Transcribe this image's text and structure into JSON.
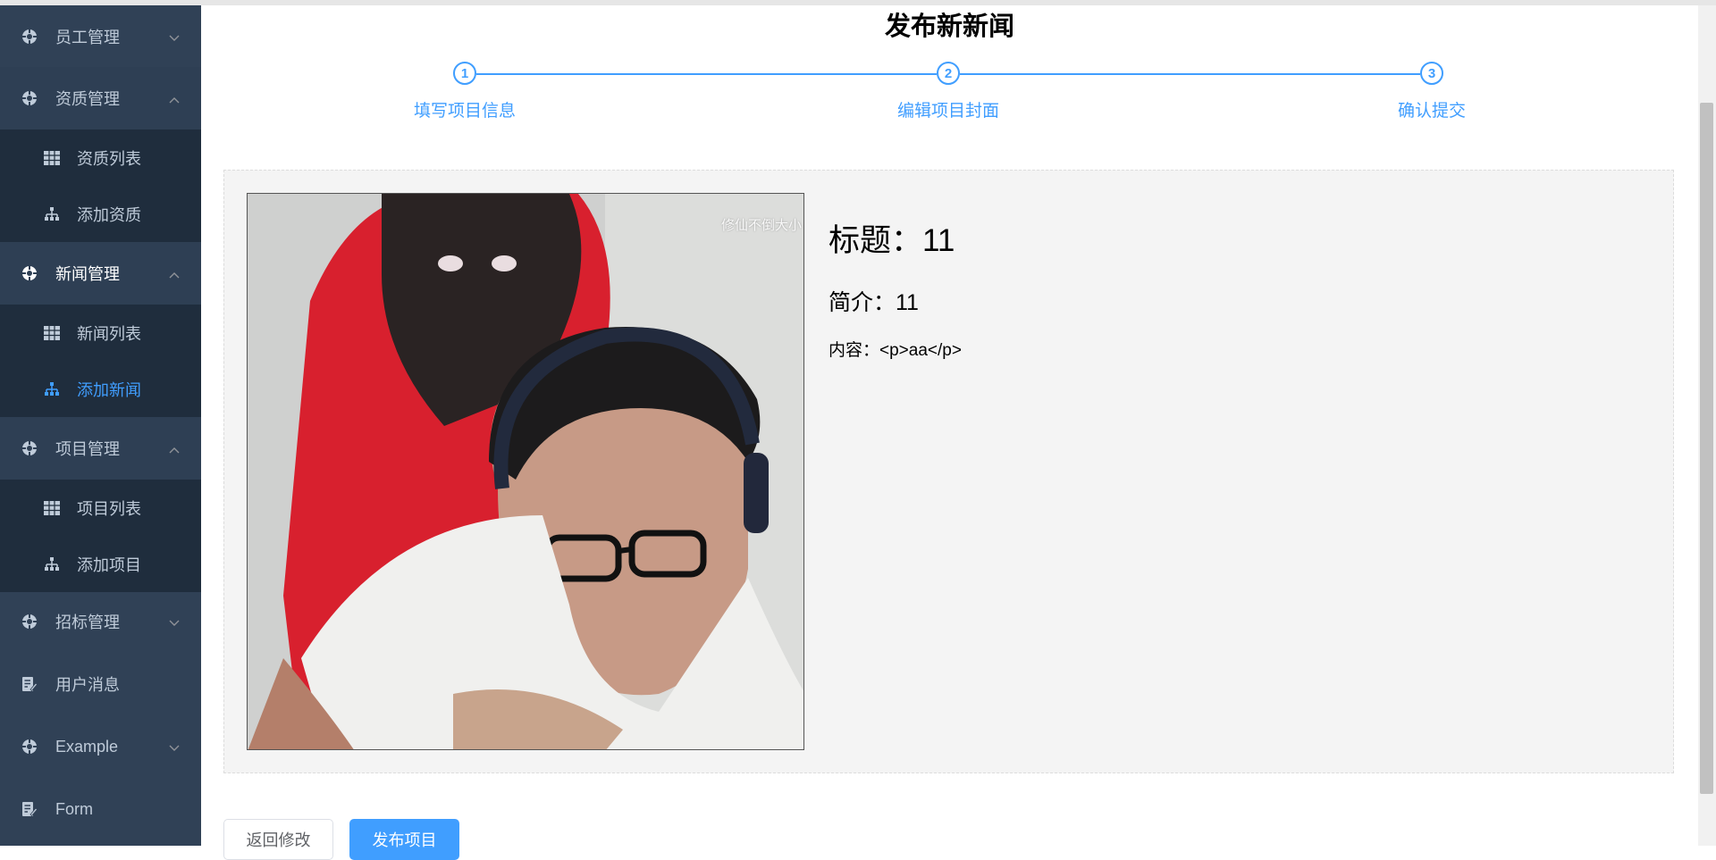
{
  "sidebar": {
    "items": [
      {
        "label": "员工管理",
        "icon": "settings-icon",
        "expanded": false
      },
      {
        "label": "资质管理",
        "icon": "settings-icon",
        "expanded": true,
        "children": [
          {
            "label": "资质列表",
            "icon": "table-icon"
          },
          {
            "label": "添加资质",
            "icon": "tree-icon"
          }
        ]
      },
      {
        "label": "新闻管理",
        "icon": "settings-icon",
        "expanded": true,
        "children": [
          {
            "label": "新闻列表",
            "icon": "table-icon"
          },
          {
            "label": "添加新闻",
            "icon": "tree-icon",
            "active": true
          }
        ]
      },
      {
        "label": "项目管理",
        "icon": "settings-icon",
        "expanded": true,
        "children": [
          {
            "label": "项目列表",
            "icon": "table-icon"
          },
          {
            "label": "添加项目",
            "icon": "tree-icon"
          }
        ]
      },
      {
        "label": "招标管理",
        "icon": "settings-icon",
        "expanded": false
      },
      {
        "label": "用户消息",
        "icon": "form-icon"
      },
      {
        "label": "Example",
        "icon": "settings-icon",
        "expanded": false
      },
      {
        "label": "Form",
        "icon": "form-icon"
      }
    ]
  },
  "page": {
    "title": "发布新新闻"
  },
  "steps": [
    {
      "number": "1",
      "label": "填写项目信息"
    },
    {
      "number": "2",
      "label": "编辑项目封面"
    },
    {
      "number": "3",
      "label": "确认提交"
    }
  ],
  "preview": {
    "watermark": "修仙不倒大小",
    "title": "标题：11",
    "intro": "简介：11",
    "content": "内容：<p>aa</p>"
  },
  "buttons": {
    "back": "返回修改",
    "publish": "发布项目"
  },
  "colors": {
    "sidebar_bg": "#304156",
    "submenu_bg": "#1f2d3d",
    "primary": "#409eff",
    "menu_text": "#bfcbd9"
  }
}
